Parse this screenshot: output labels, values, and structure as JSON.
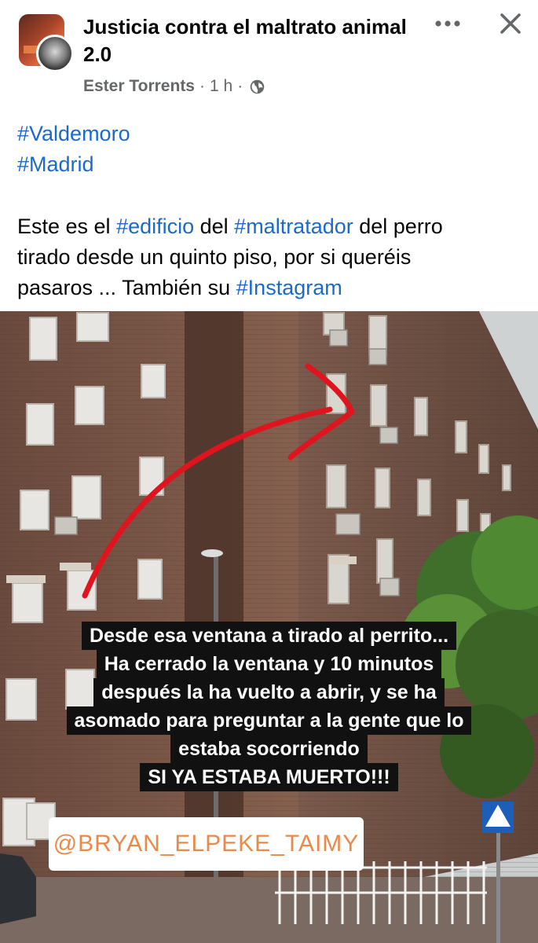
{
  "header": {
    "page_name": "Justicia contra el maltrato animal 2.0",
    "author": "Ester Torrents",
    "separator": "·",
    "time": "1 h",
    "privacy_icon": "globe-icon",
    "more_icon": "more-horizontal-icon",
    "close_icon": "close-icon"
  },
  "post": {
    "hashtag_1": "#Valdemoro",
    "hashtag_2": "#Madrid",
    "body": {
      "t1": "Este es el ",
      "h1": "#edificio",
      "t2": " del ",
      "h2": "#maltratador",
      "t3": " del perro",
      "t4": "tirado desde un quinto piso, por si queréis",
      "t5": "pasaros ... También su ",
      "h3": "#Instagram"
    }
  },
  "photo": {
    "caption_lines": [
      "Desde esa ventana a tirado al perrito...",
      "Ha cerrado la ventana y 10 minutos",
      "después la ha vuelto a abrir, y se ha",
      "asomado para preguntar a la gente que lo",
      "estaba socorriendo",
      "SI YA ESTABA MUERTO!!!"
    ],
    "instagram_handle": "@BRYAN_ELPEKE_TAIMY"
  },
  "colors": {
    "hashtag": "#1b6ac9",
    "meta_text": "#65676b",
    "arrow": "#e0141e",
    "handle_text": "#e9894a"
  }
}
